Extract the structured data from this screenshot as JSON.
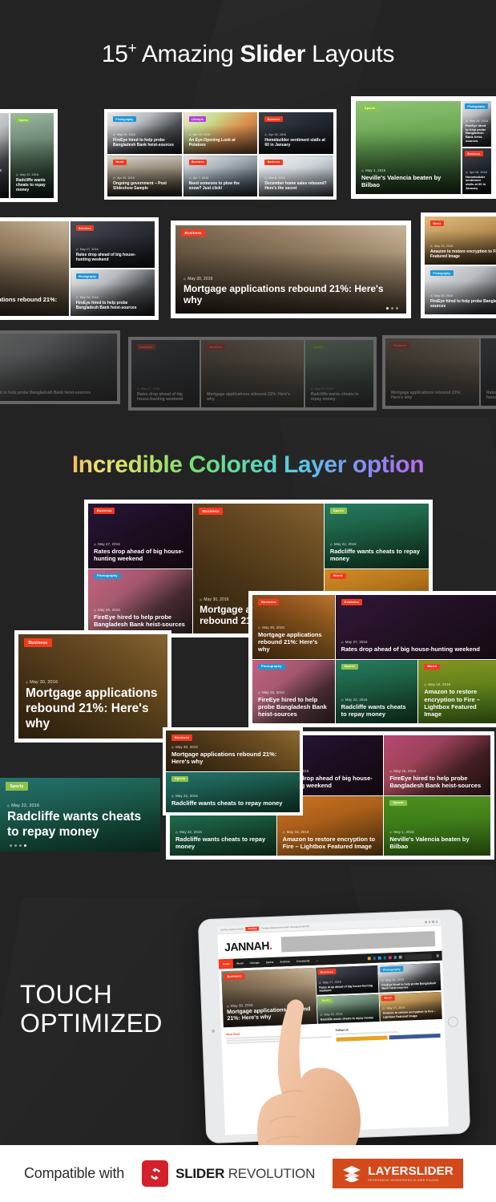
{
  "headings": {
    "title_pre": "15",
    "title_sup": "+",
    "title_mid": " Amazing ",
    "title_bold": "Slider",
    "title_post": " Layouts",
    "colored_title": "Incredible Colored Layer option",
    "touch_line1": "TOUCH",
    "touch_line2": "OPTIMIZED"
  },
  "badges": {
    "business": "Business",
    "photography": "Photography",
    "sports": "Sports",
    "world": "World",
    "lifestyle": "Lifestyle"
  },
  "articles": {
    "mortgage": {
      "title": "Mortgage applications rebound 21%: Here's why",
      "date": "May 30, 2016",
      "category": "Business"
    },
    "rates": {
      "title": "Rates drop ahead of big house-hunting weekend",
      "date": "May 27, 2016",
      "category": "Business"
    },
    "fireeye": {
      "title": "FireEye hired to help probe Bangladesh Bank heist-sources",
      "date": "May 26, 2016",
      "category": "Photography"
    },
    "radcliffe": {
      "title": "Radcliffe wants cheats to repay money",
      "date": "May 22, 2016",
      "category": "Sports"
    },
    "amazon": {
      "title": "Amazon to restore encryption to Fire – Lightbox Featured Image",
      "date": "May 15, 2016",
      "category": "World"
    },
    "neville": {
      "title": "Neville's Valencia beaten by Bilbao",
      "date": "May 1, 2016",
      "category": "Sports"
    },
    "potatoes": {
      "title": "An Eye-Opening Look at Potatoes",
      "date": "Apr 15, 2016",
      "category": "Lifestyle"
    },
    "homebuilder": {
      "title": "Homebuilder sentiment stalls at 60 in January",
      "date": "Apr 18, 2016",
      "category": "Business"
    },
    "ongoing": {
      "title": "Ongoing government – Post Slideshow Sample",
      "date": "Apr 20, 2016",
      "category": "World"
    },
    "needsomeone": {
      "title": "Need someone to plow the snow? Just click!",
      "date": "Apr 7, 2016",
      "category": "Business"
    },
    "december": {
      "title": "December home sales rebound? Here's the secret",
      "date": "Mar 6, 2016",
      "category": "Business"
    }
  },
  "tablet": {
    "browser_date": "Sunday, August 14 2016",
    "trending_label": "Trending",
    "browser_headline": "Pentagon Early Access Event: Thursday 10 AM PST",
    "logo": "JANNAH",
    "logo_dot": ".",
    "nav": [
      "Home",
      "World",
      "Lifestyle",
      "Sports",
      "Archives",
      "Community",
      "..."
    ],
    "search_placeholder": "Search for",
    "must_read": "Must Read",
    "follow_us": "Follow Us",
    "must_read_tabs": [
      "Best way",
      "Posts"
    ]
  },
  "footer": {
    "compatible_with": "Compatible with",
    "slider_revolution_bold": "SLIDER",
    "slider_revolution_light": " REVOLUTION",
    "layerslider_name": "LAYERSLIDER",
    "layerslider_sub": "RESPONSIVE WORDPRESS SLIDER PLUGIN"
  },
  "colors": {
    "background": "#232323",
    "accent_red": "#f4391f",
    "badge_photography": "#2196d6",
    "badge_sports": "#8bc34a",
    "slider_revolution_red": "#d4202a",
    "layerslider_orange": "#d4491c"
  }
}
